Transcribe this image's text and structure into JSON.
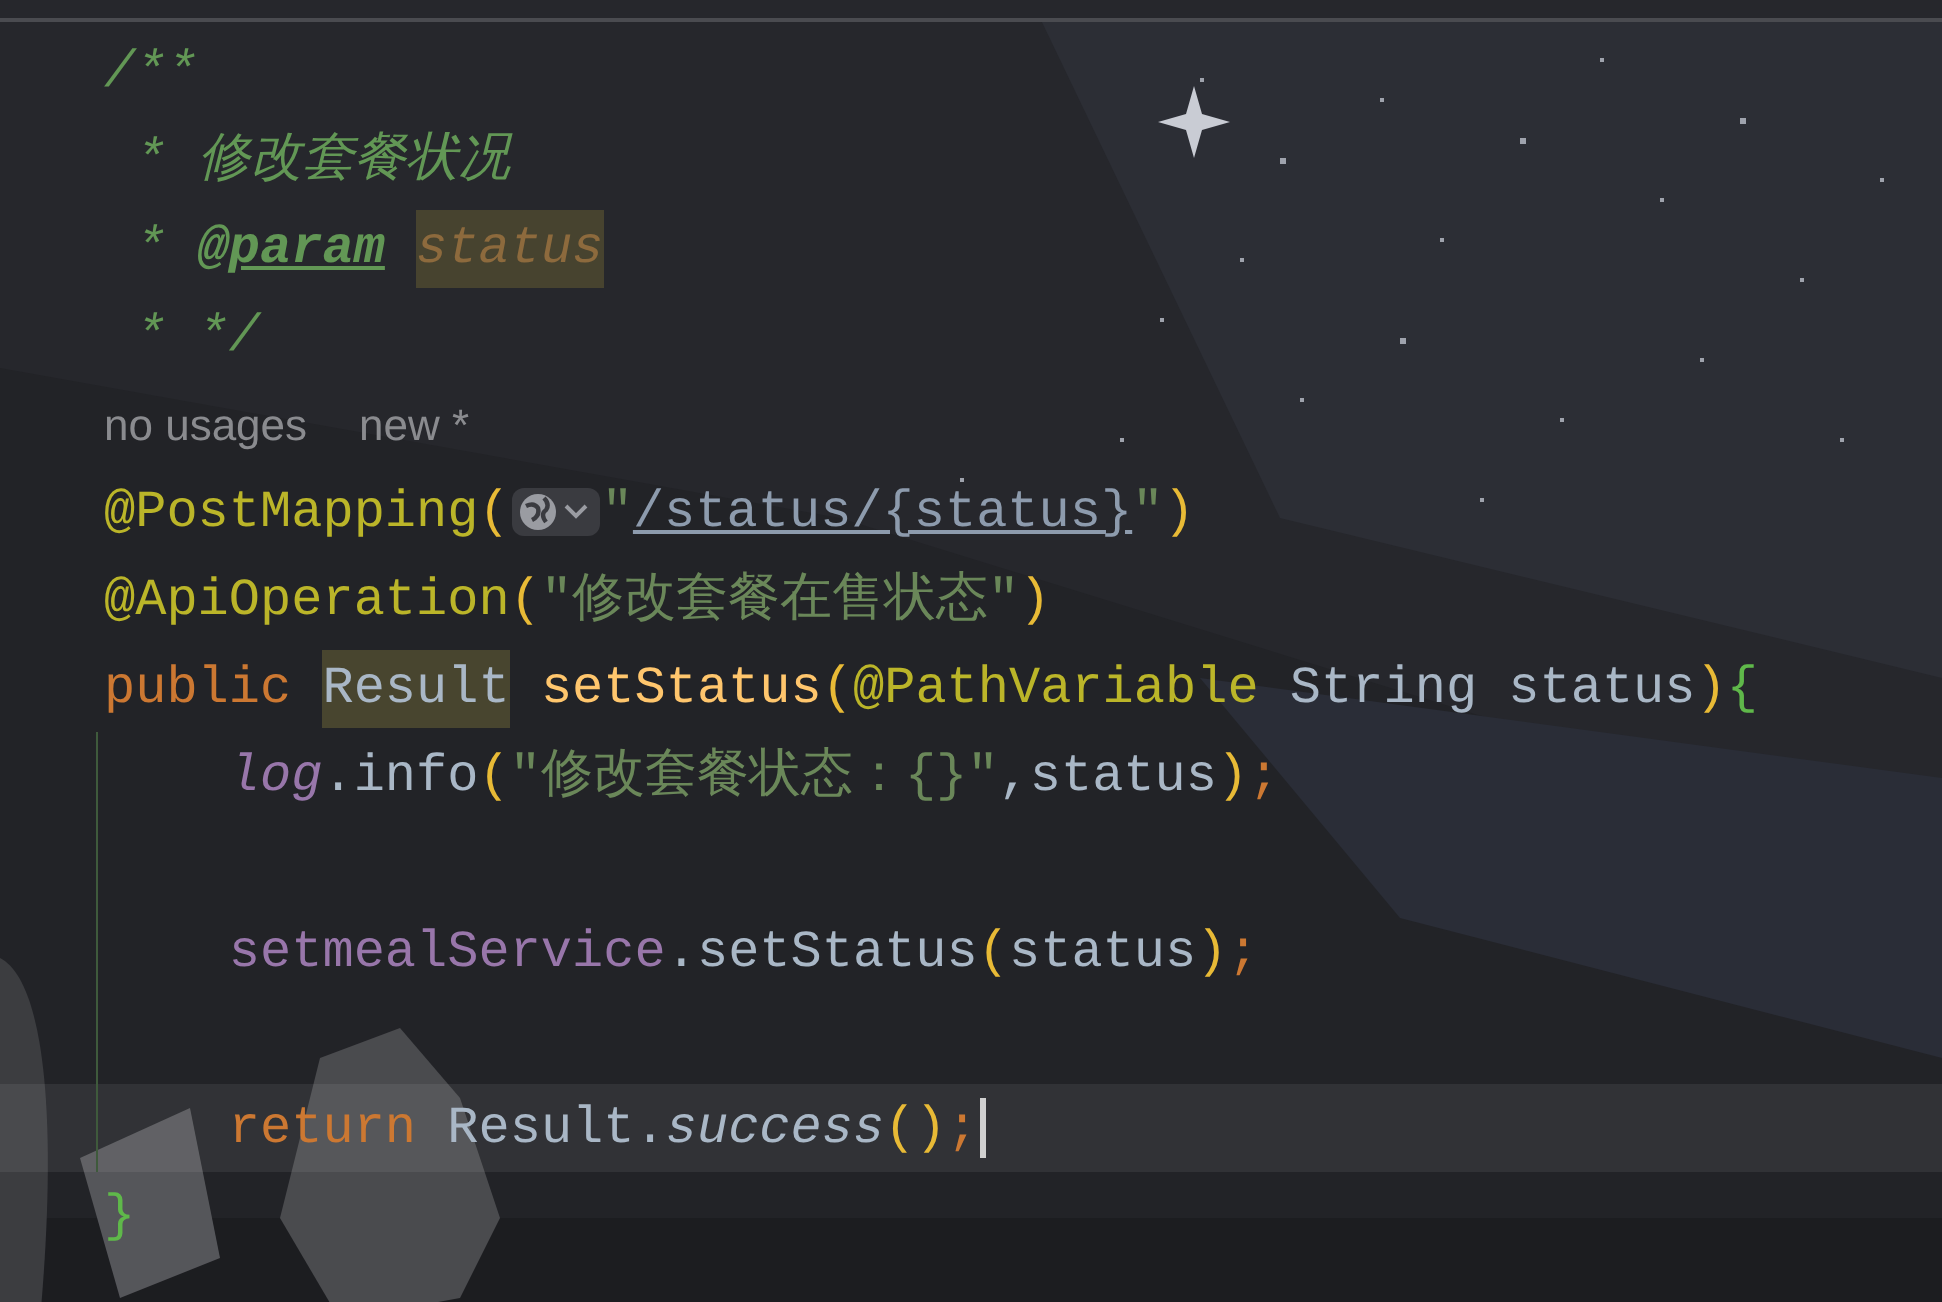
{
  "editor": {
    "lines": [
      {
        "kind": "code",
        "current": false,
        "tokens": [
          {
            "kind": "comment",
            "text": "/**",
            "highlighted": false
          }
        ]
      },
      {
        "kind": "code",
        "current": false,
        "tokens": [
          {
            "kind": "comment",
            "text": " * 修改套餐状况",
            "highlighted": false
          }
        ]
      },
      {
        "kind": "code",
        "current": false,
        "tokens": [
          {
            "kind": "comment",
            "text": " * ",
            "highlighted": false
          },
          {
            "kind": "doctag",
            "text": "@param",
            "highlighted": false
          },
          {
            "kind": "param",
            "text": "status",
            "highlighted": true
          }
        ]
      },
      {
        "kind": "code",
        "current": false,
        "tokens": [
          {
            "kind": "comment",
            "text": " * */",
            "highlighted": false
          }
        ]
      },
      {
        "kind": "hint",
        "current": false,
        "texts": [
          "no usages",
          "new *"
        ]
      },
      {
        "kind": "code",
        "current": false,
        "tokens": [
          {
            "kind": "annotation",
            "text": "@PostMapping",
            "highlighted": false
          },
          {
            "kind": "paren",
            "text": "(",
            "highlighted": false
          },
          {
            "kind": "globe",
            "highlighted": false
          },
          {
            "kind": "string",
            "text": "\"",
            "highlighted": false
          },
          {
            "kind": "link",
            "text": "/status/{status}",
            "highlighted": false
          },
          {
            "kind": "string",
            "text": "\"",
            "highlighted": false
          },
          {
            "kind": "paren",
            "text": ")",
            "highlighted": false
          }
        ]
      },
      {
        "kind": "code",
        "current": false,
        "tokens": [
          {
            "kind": "annotation",
            "text": "@ApiOperation",
            "highlighted": false
          },
          {
            "kind": "paren",
            "text": "(",
            "highlighted": false
          },
          {
            "kind": "string",
            "text": "\"修改套餐在售状态\"",
            "highlighted": false
          },
          {
            "kind": "paren",
            "text": ")",
            "highlighted": false
          }
        ]
      },
      {
        "kind": "code",
        "current": false,
        "tokens": [
          {
            "kind": "keyword",
            "text": "public ",
            "highlighted": false
          },
          {
            "kind": "plain",
            "text": "Result",
            "highlighted": true
          },
          {
            "kind": "method",
            "text": " setStatus",
            "highlighted": false
          },
          {
            "kind": "paren",
            "text": "(",
            "highlighted": false
          },
          {
            "kind": "annotation",
            "text": "@PathVariable",
            "highlighted": false
          },
          {
            "kind": "plain",
            "text": " String status",
            "highlighted": false
          },
          {
            "kind": "paren",
            "text": ")",
            "highlighted": false
          },
          {
            "kind": "brace",
            "text": "{",
            "highlighted": false
          }
        ]
      },
      {
        "kind": "code",
        "current": false,
        "tokens": [
          {
            "kind": "field",
            "text": "    log",
            "highlighted": false
          },
          {
            "kind": "plain",
            "text": ".info",
            "highlighted": false
          },
          {
            "kind": "paren",
            "text": "(",
            "highlighted": false
          },
          {
            "kind": "string",
            "text": "\"修改套餐状态：{}\"",
            "highlighted": false
          },
          {
            "kind": "plain",
            "text": ",status",
            "highlighted": false
          },
          {
            "kind": "paren",
            "text": ")",
            "highlighted": false
          },
          {
            "kind": "punct",
            "text": ";",
            "highlighted": false
          }
        ]
      },
      {
        "kind": "blank",
        "current": false
      },
      {
        "kind": "code",
        "current": false,
        "tokens": [
          {
            "kind": "member",
            "text": "    setmealService",
            "highlighted": false
          },
          {
            "kind": "plain",
            "text": ".setStatus",
            "highlighted": false
          },
          {
            "kind": "paren",
            "text": "(",
            "highlighted": false
          },
          {
            "kind": "plain",
            "text": "status",
            "highlighted": false
          },
          {
            "kind": "paren",
            "text": ")",
            "highlighted": false
          },
          {
            "kind": "punct",
            "text": ";",
            "highlighted": false
          }
        ]
      },
      {
        "kind": "blank",
        "current": false
      },
      {
        "kind": "code",
        "current": true,
        "tokens": [
          {
            "kind": "keyword",
            "text": "    return",
            "highlighted": false
          },
          {
            "kind": "plain",
            "text": " Result.",
            "highlighted": false
          },
          {
            "kind": "static",
            "text": "success",
            "highlighted": false
          },
          {
            "kind": "paren",
            "text": "()",
            "highlighted": false
          },
          {
            "kind": "punct",
            "text": ";",
            "highlighted": false
          }
        ]
      },
      {
        "kind": "code",
        "current": false,
        "tokens": [
          {
            "kind": "brace",
            "text": "}",
            "highlighted": false
          }
        ]
      }
    ]
  }
}
